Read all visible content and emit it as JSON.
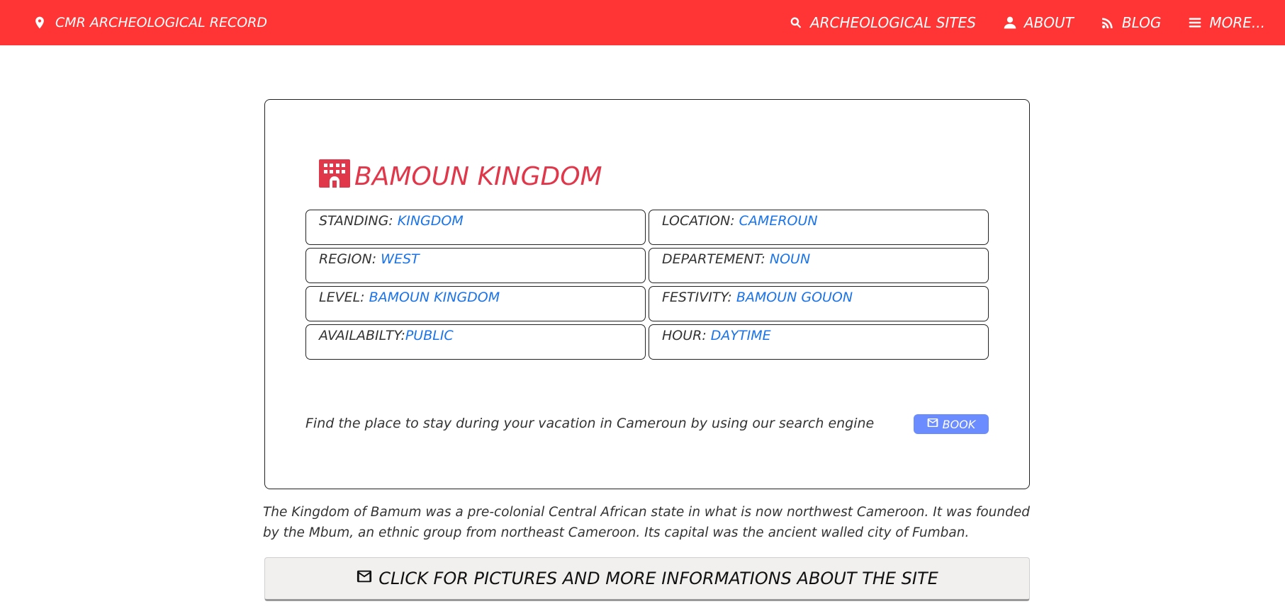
{
  "navbar": {
    "brand": "CMR ARCHEOLOGICAL RECORD",
    "links": [
      {
        "label": "ARCHEOLOGICAL SITES",
        "icon": "search-icon"
      },
      {
        "label": "ABOUT",
        "icon": "user-icon"
      },
      {
        "label": "BLOG",
        "icon": "rss-icon"
      },
      {
        "label": "MORE...",
        "icon": "menu-icon"
      }
    ]
  },
  "site": {
    "title": "BAMOUN KINGDOM",
    "fields": [
      {
        "label": "STANDING: ",
        "value": "KINGDOM"
      },
      {
        "label": "LOCATION: ",
        "value": "CAMEROUN"
      },
      {
        "label": "REGION: ",
        "value": "WEST"
      },
      {
        "label": "DEPARTEMENT: ",
        "value": "NOUN"
      },
      {
        "label": "LEVEL: ",
        "value": "BAMOUN KINGDOM"
      },
      {
        "label": "FESTIVITY: ",
        "value": "BAMOUN GOUON"
      },
      {
        "label": "AVAILABILTY:",
        "value": "PUBLIC"
      },
      {
        "label": "HOUR: ",
        "value": "DAYTIME"
      }
    ],
    "book_text": "Find the place to stay during your vacation in Cameroun by using our search engine",
    "book_label": "BOOK"
  },
  "description": "The Kingdom of Bamum was a pre-colonial Central African state in what is now northwest Cameroon. It was founded by the Mbum, an ethnic group from northeast Cameroon. Its capital was the ancient walled city of Fumban.",
  "more_button": "CLICK FOR PICTURES AND MORE INFORMATIONS ABOUT THE SITE",
  "colors": {
    "navbar": "#ff3434",
    "title": "#e0374a",
    "value": "#1a73e8",
    "book_button": "#6b8cff"
  }
}
